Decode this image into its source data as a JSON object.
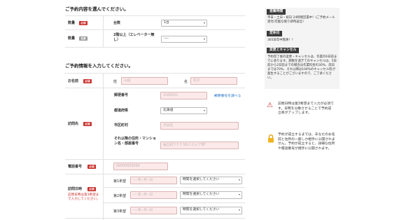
{
  "section1": {
    "title": "ご予約内容を選んでください。"
  },
  "quantity": {
    "label": "数量",
    "badge": "必須",
    "field_label": "台数",
    "value": "1台",
    "arrow": "▾"
  },
  "quantity2": {
    "label": "数量",
    "badge": "任意",
    "field_label": "2階以上（エレベーター無し）",
    "value": "----",
    "arrow": "▾"
  },
  "section2": {
    "title": "ご予約情報を入力してください。"
  },
  "name": {
    "label": "お名前",
    "badge": "必須",
    "last_label": "姓",
    "last_placeholder": "山田",
    "first_label": "名",
    "first_placeholder": "花子"
  },
  "address": {
    "label": "訪問先",
    "badge": "必須",
    "zip_label": "郵便番号",
    "zip_placeholder": "1500031",
    "zip_link": "郵便番号を調べる",
    "pref_label": "都道府県",
    "pref_value": "北海道",
    "city_label": "市区町村",
    "city_placeholder": "渋谷区",
    "street_label": "それ以降の住所・マンション名・部屋番号",
    "street_placeholder": "桜丘町7-7-7 SGスクエアBF"
  },
  "phone": {
    "label": "電話番号",
    "badge": "必須",
    "placeholder": "09000000000"
  },
  "visit": {
    "label": "訪問日時",
    "badge": "必須",
    "note": "訪問日時は第3希望まで入力してください。",
    "rows": [
      {
        "label": "第1希望",
        "date_placeholder": "----年--月--日",
        "time_value": "時間を選択してください"
      },
      {
        "label": "第2希望",
        "date_placeholder": "----年--月--日",
        "time_value": "時間を選択してください"
      },
      {
        "label": "第3希望",
        "date_placeholder": "----年--月--日",
        "time_value": "時間を選択してください"
      }
    ]
  },
  "sidebar": {
    "hours_title": "営業時間",
    "hours_text": "平日・土日・祝日 24時間営業中！(ご予約メール受付)可能な限り即時返信！",
    "holiday_title": "定休日",
    "holiday_text": "365日年中無休！！",
    "change_title": "変更とキャンセル",
    "change_text": "予約完了後の変更・キャンセルは、作業の6日前までに承ります。期限を過ぎてのキャンセルは、5日前から2日前までの場合は作業料金の30%、前日までは70%、それ以降は100%のキャンセル料が発生することがございますので、ご了承ください。"
  },
  "info1": {
    "icon": "⚠",
    "text": "訪問日時は第3希望まで入力が必須です。日時を分散させることで予約成立率がアップします。"
  },
  "info2": {
    "icon": "🔒",
    "text": "予約が成立するまでは、あなたのお名前と住所の一部しか相手に公開されません。予約が成立すると、詳細な住所や電話番号が相手に公開されます。"
  },
  "colors": {
    "required": "#c9302c",
    "optional": "#9a9a9a",
    "input_bg": "#fce9e9",
    "link": "#1f6fc7"
  }
}
